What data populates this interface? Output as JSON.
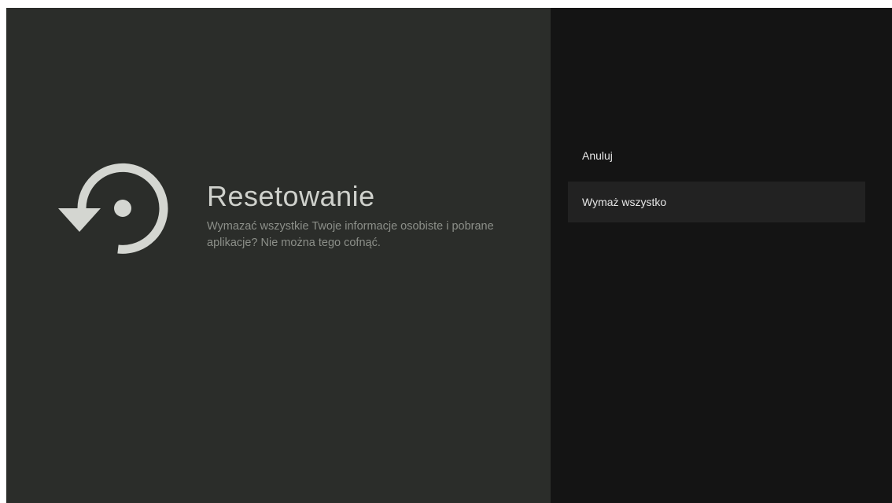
{
  "reset_screen": {
    "title": "Resetowanie",
    "description": "Wymazać wszystkie Twoje informacje osobiste i pobrane aplikacje? Nie można tego cofnąć.",
    "icon": "restore-icon"
  },
  "menu": {
    "items": [
      {
        "label": "Anuluj",
        "selected": false
      },
      {
        "label": "Wymaż wszystko",
        "selected": true
      }
    ]
  },
  "colors": {
    "left_panel_bg": "#2b2d2a",
    "right_panel_bg": "#141414",
    "selected_item_bg": "#222222",
    "icon_color": "#d4d6d1"
  }
}
